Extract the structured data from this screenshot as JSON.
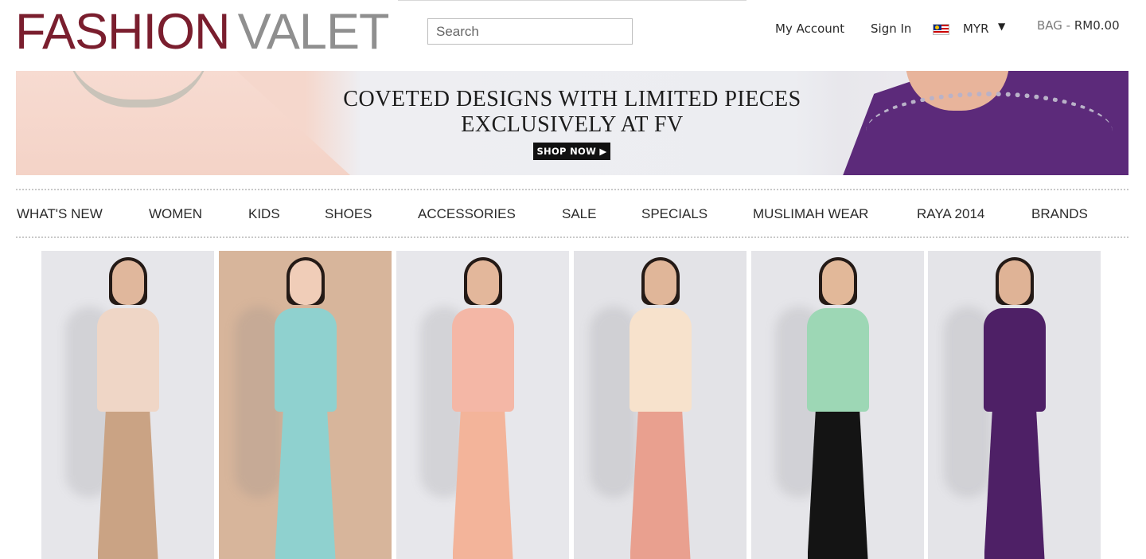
{
  "header": {
    "logo_part1": "FASHION",
    "logo_part2": "VALET",
    "search_placeholder": "Search",
    "my_account": "My Account",
    "sign_in": "Sign In",
    "currency": "MYR",
    "bag_label": "BAG - ",
    "bag_amount": "RM0.00"
  },
  "banner": {
    "line1": "COVETED DESIGNS WITH LIMITED PIECES",
    "line2": "EXCLUSIVELY AT FV",
    "cta": "SHOP NOW ▶"
  },
  "nav": [
    "WHAT'S NEW",
    "WOMEN",
    "KIDS",
    "SHOES",
    "ACCESSORIES",
    "SALE",
    "SPECIALS",
    "MUSLIMAH WEAR",
    "RAYA 2014",
    "BRANDS"
  ],
  "colors": {
    "brand_primary": "#7a1e2e",
    "brand_secondary": "#8f8f8f"
  },
  "products": [
    {
      "name": "product-tile-1",
      "bg": "#e6e6ea",
      "top": "#efd6c6",
      "bottom": "#caa384",
      "skin": "#e0b79c"
    },
    {
      "name": "product-tile-2",
      "bg": "#d7b59b",
      "top": "#8fd1cf",
      "bottom": "#8fd1cf",
      "skin": "#f0cdb8"
    },
    {
      "name": "product-tile-3",
      "bg": "#e7e7eb",
      "top": "#f4b7a6",
      "bottom": "#f3b49a",
      "skin": "#e3b79b"
    },
    {
      "name": "product-tile-4",
      "bg": "#e3e3e7",
      "top": "#f7e2cc",
      "bottom": "#e9a08f",
      "skin": "#e0b699"
    },
    {
      "name": "product-tile-5",
      "bg": "#e5e5e9",
      "top": "#9dd7b5",
      "bottom": "#141414",
      "skin": "#e2b899"
    },
    {
      "name": "product-tile-6",
      "bg": "#e4e4e8",
      "top": "#4e2066",
      "bottom": "#4e2066",
      "skin": "#dfb396"
    }
  ]
}
